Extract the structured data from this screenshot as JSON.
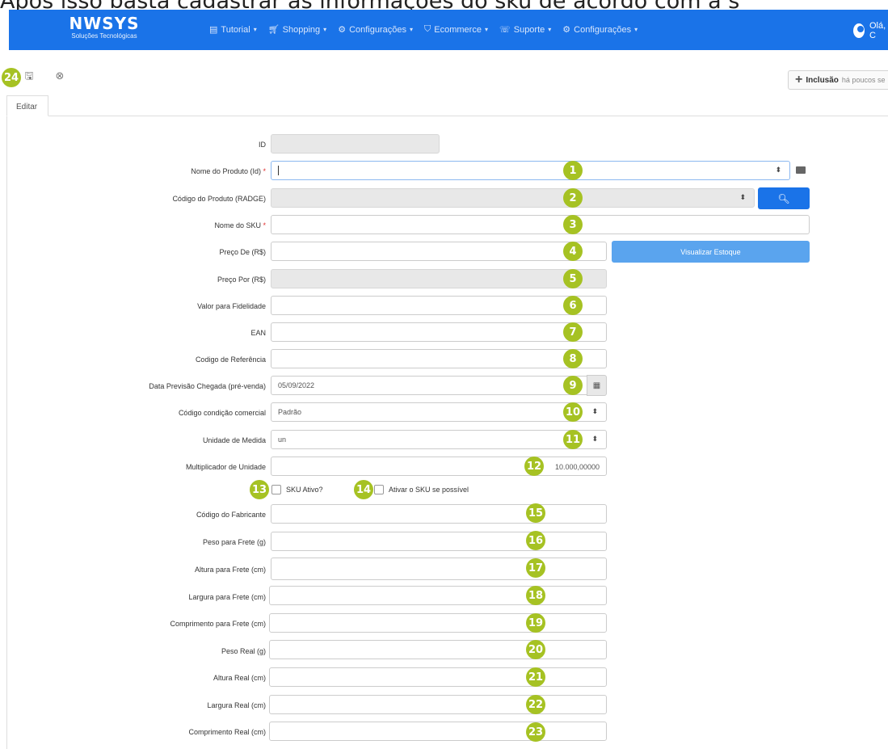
{
  "caption": "Após isso basta cadastrar as informações do sku de acordo com a s",
  "navbar": {
    "logo_title": "NWSYS",
    "logo_subtitle": "Soluções Tecnológicas",
    "menu": [
      {
        "label": "Tutorial",
        "icon": "book-icon"
      },
      {
        "label": "Shopping",
        "icon": "cart-icon"
      },
      {
        "label": "Configurações",
        "icon": "cogs-icon"
      },
      {
        "label": "Ecommerce",
        "icon": "basket-icon"
      },
      {
        "label": "Suporte",
        "icon": "support-icon"
      },
      {
        "label": "Configurações",
        "icon": "gear-icon"
      }
    ],
    "user_greeting": "Olá, C"
  },
  "toolbar": {
    "badge": "24",
    "save_icon": "save-icon",
    "cancel_icon": "circle-x-icon"
  },
  "inclusao": {
    "label": "Inclusão",
    "time": "há poucos se"
  },
  "tab": {
    "label": "Editar"
  },
  "form": {
    "id": {
      "label": "ID"
    },
    "nome_produto": {
      "label": "Nome do Produto (Id)",
      "req": "*",
      "badge": "1"
    },
    "codigo_produto": {
      "label": "Código do Produto (RADGE)",
      "badge": "2"
    },
    "nome_sku": {
      "label": "Nome do SKU",
      "req": "*",
      "badge": "3"
    },
    "preco_de": {
      "label": "Preço De (R$)",
      "badge": "4"
    },
    "preco_por": {
      "label": "Preço Por (R$)",
      "badge": "5"
    },
    "valor_fidelidade": {
      "label": "Valor para Fidelidade",
      "badge": "6"
    },
    "ean": {
      "label": "EAN",
      "badge": "7"
    },
    "codigo_referencia": {
      "label": "Codigo de Referência",
      "badge": "8"
    },
    "data_previsao": {
      "label": "Data Previsão Chegada (pré-venda)",
      "value": "05/09/2022",
      "badge": "9"
    },
    "condicao_comercial": {
      "label": "Código condição comercial",
      "value": "Padrão",
      "badge": "10"
    },
    "unidade_medida": {
      "label": "Unidade de Medida",
      "value": "un",
      "badge": "11"
    },
    "multiplicador": {
      "label": "Multiplicador de Unidade",
      "value": "10.000,00000",
      "badge": "12"
    },
    "sku_ativo": {
      "label": "SKU Ativo?",
      "badge": "13"
    },
    "ativar_sku": {
      "label": "Ativar o SKU se possível",
      "badge": "14"
    },
    "codigo_fabricante": {
      "label": "Código do Fabricante",
      "badge": "15"
    },
    "peso_frete": {
      "label": "Peso para Frete (g)",
      "badge": "16"
    },
    "altura_frete": {
      "label": "Altura para Frete (cm)",
      "badge": "17"
    },
    "largura_frete": {
      "label": "Largura para Frete (cm)",
      "badge": "18"
    },
    "comprimento_frete": {
      "label": "Comprimento para Frete (cm)",
      "badge": "19"
    },
    "peso_real": {
      "label": "Peso Real (g)",
      "badge": "20"
    },
    "altura_real": {
      "label": "Altura Real (cm)",
      "badge": "21"
    },
    "largura_real": {
      "label": "Largura Real (cm)",
      "badge": "22"
    },
    "comprimento_real": {
      "label": "Comprimento Real (cm)",
      "badge": "23"
    }
  },
  "buttons": {
    "search_icon": "search-icon",
    "visualizar_estoque": "Visualizar Estoque"
  }
}
